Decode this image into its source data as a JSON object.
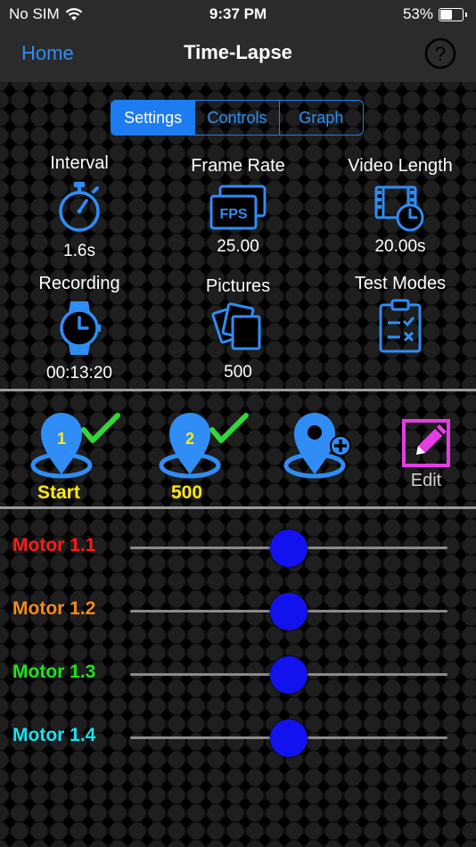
{
  "status_bar": {
    "carrier": "No SIM",
    "time": "9:37 PM",
    "battery_percent": "53%",
    "battery_level": 0.53
  },
  "nav": {
    "back_label": "Home",
    "title": "Time-Lapse",
    "help_icon": "question-circle-icon"
  },
  "tabs": [
    {
      "label": "Settings",
      "active": true
    },
    {
      "label": "Controls",
      "active": false
    },
    {
      "label": "Graph",
      "active": false
    }
  ],
  "settings": [
    {
      "label": "Interval",
      "value": "1.6s",
      "icon": "stopwatch-icon"
    },
    {
      "label": "Frame Rate",
      "value": "25.00",
      "icon": "fps-icon",
      "icon_text": "FPS"
    },
    {
      "label": "Video Length",
      "value": "20.00s",
      "icon": "film-clock-icon"
    },
    {
      "label": "Recording",
      "value": "00:13:20",
      "icon": "watch-icon"
    },
    {
      "label": "Pictures",
      "value": "500",
      "icon": "photos-icon"
    },
    {
      "label": "Test Modes",
      "value": "",
      "icon": "clipboard-check-icon"
    }
  ],
  "waypoints": [
    {
      "number": "1",
      "label": "Start",
      "icon": "location-pin-check-icon"
    },
    {
      "number": "2",
      "label": "500",
      "icon": "location-pin-check-icon"
    },
    {
      "number": "",
      "label": "",
      "icon": "add-location-icon"
    },
    {
      "label": "Edit",
      "icon": "edit-pencil-icon"
    }
  ],
  "motors": [
    {
      "name": "Motor 1.1",
      "color": "#ff1a1a",
      "position": 0.5
    },
    {
      "name": "Motor 1.2",
      "color": "#f58a1f",
      "position": 0.5
    },
    {
      "name": "Motor 1.3",
      "color": "#1fe21f",
      "position": 0.5
    },
    {
      "name": "Motor 1.4",
      "color": "#19e3ee",
      "position": 0.5
    }
  ],
  "colors": {
    "accent": "#1e7cf2",
    "icon_blue": "#2f8df5",
    "waypoint_label": "#ffe81a",
    "check_green": "#33d63a",
    "edit_magenta": "#e53ce5",
    "knob": "#1212ef"
  }
}
